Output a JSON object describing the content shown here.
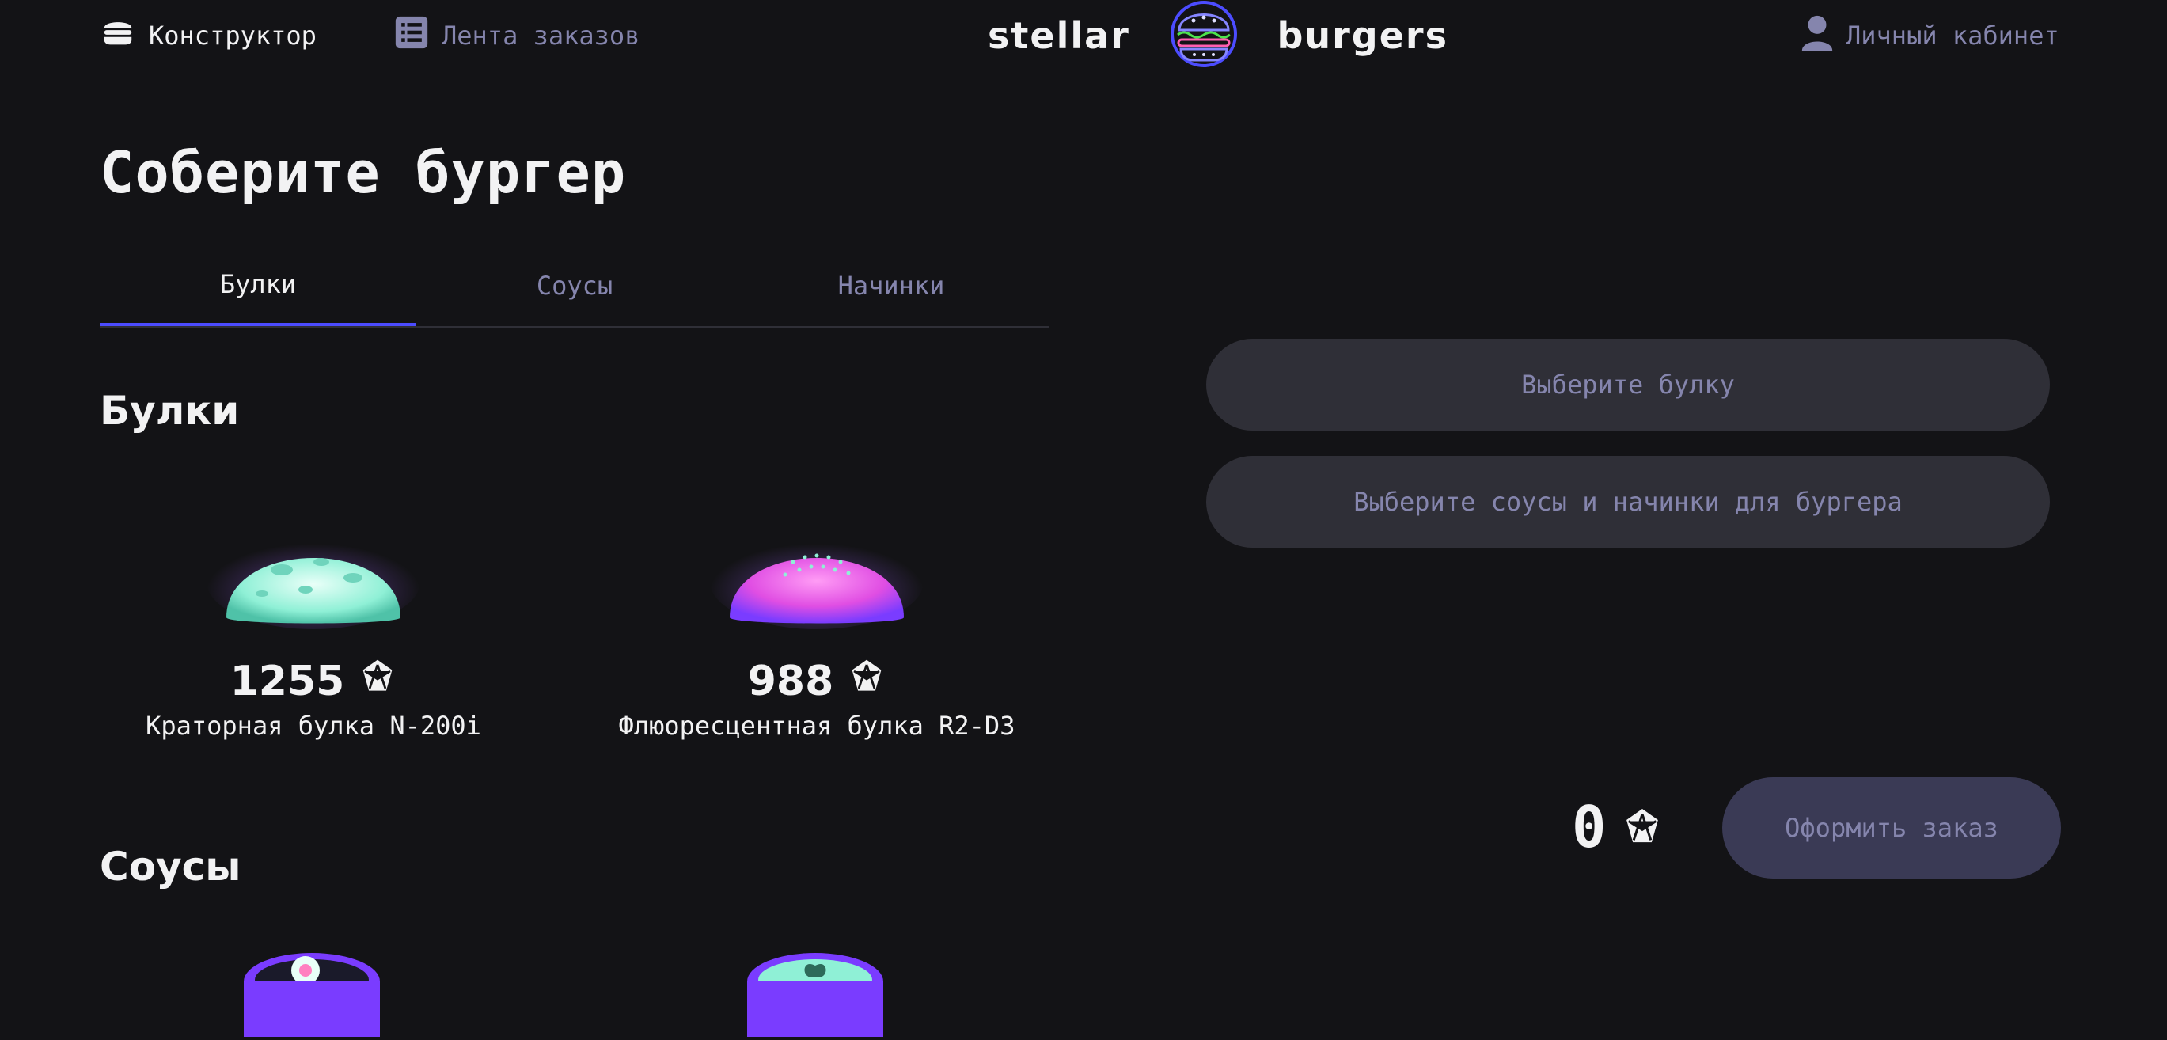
{
  "header": {
    "nav": {
      "constructor_label": "Конструктор",
      "feed_label": "Лента заказов",
      "profile_label": "Личный кабинет"
    },
    "logo": {
      "left_word": "stellar",
      "right_word": "burgers"
    }
  },
  "main": {
    "title": "Соберите бургер",
    "tabs": [
      {
        "label": "Булки",
        "active": true
      },
      {
        "label": "Соусы",
        "active": false
      },
      {
        "label": "Начинки",
        "active": false
      }
    ],
    "sections": {
      "buns": {
        "heading": "Булки",
        "items": [
          {
            "price": "1255",
            "name": "Краторная булка N-200i",
            "color": "#7fe3c9"
          },
          {
            "price": "988",
            "name": "Флюоресцентная булка R2-D3",
            "color": "#e04ee3"
          }
        ]
      },
      "sauces": {
        "heading": "Соусы"
      }
    }
  },
  "constructor": {
    "bun_placeholder": "Выберите булку",
    "fillings_placeholder": "Выберите соусы и начинки для бургера",
    "total": "0",
    "order_button": "Оформить заказ"
  },
  "colors": {
    "background": "#131316",
    "accent": "#4c4cff",
    "inactive_text": "#8585ad",
    "panel": "#2f2f37"
  },
  "icons": [
    "burger-icon",
    "list-icon",
    "profile-icon",
    "currency-icon"
  ]
}
